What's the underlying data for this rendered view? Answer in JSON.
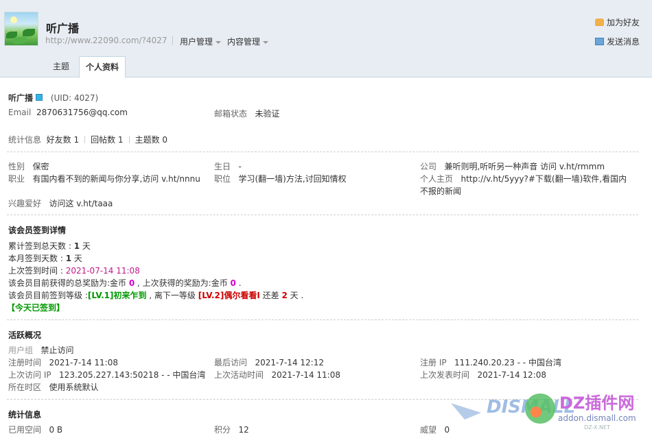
{
  "header": {
    "username": "听广播",
    "url": "http://www.22090.com/?4027",
    "menu_user": "用户管理",
    "menu_content": "内容管理",
    "add_friend": "加为好友",
    "send_message": "发送消息"
  },
  "tabs": [
    {
      "label": "主题"
    },
    {
      "label": "个人资料"
    }
  ],
  "profile": {
    "name": "听广播",
    "uid": "(UID: 4027)",
    "email_label": "Email",
    "email_value": "2870631756@qq.com",
    "email_status_label": "邮箱状态",
    "email_status_value": "未验证",
    "stats_label": "统计信息",
    "friends": "好友数 1",
    "replies": "回帖数 1",
    "threads": "主题数 0"
  },
  "details": {
    "gender_label": "性别",
    "gender_value": "保密",
    "birthday_label": "生日",
    "birthday_value": "-",
    "company_label": "公司",
    "company_value": "兼听则明,听听另一种声音 访问 v.ht/rmmm",
    "occupation_label": "职业",
    "occupation_value": "有国内看不到的新闻与你分享,访问 v.ht/nnnu",
    "position_label": "职位",
    "position_value": "学习(翻一墙)方法,讨回知情权",
    "homepage_label": "个人主页",
    "homepage_value_1": "http://v.ht/5yyy?#下载(翻一墙)软件,看国内",
    "homepage_value_2": "不报的新闻",
    "hobby_label": "兴趣爱好",
    "hobby_value": "访问这 v.ht/taaa"
  },
  "checkin": {
    "title": "该会员签到详情",
    "total_prefix": "累计签到总天数 : ",
    "total_days": "1",
    "total_suffix": " 天",
    "month_prefix": "本月签到天数 : ",
    "month_days": "1",
    "month_suffix": " 天",
    "last_prefix": "上次签到时间 : ",
    "last_time": "2021-07-14 11:08",
    "reward_prefix": "该会员目前获得的总奖励为:金币 ",
    "reward_total": "0",
    "reward_mid": " , 上次获得的奖励为:金币 ",
    "reward_last": "0",
    "reward_suffix": " .",
    "level_prefix": "该会员目前签到等级 :",
    "level_current": "[LV.1]初来乍到",
    "level_mid": " , 离下一等级 ",
    "level_next": "[LV.2]偶尔看看I",
    "level_gap_prefix": " 还差 ",
    "level_gap": "2",
    "level_gap_suffix": " 天 .",
    "today_status": "【今天已签到】"
  },
  "activity": {
    "title": "活跃概况",
    "group_label": "用户组",
    "group_value": "禁止访问",
    "reg_time_label": "注册时间",
    "reg_time_value": "2021-7-14 11:08",
    "last_visit_label": "最后访问",
    "last_visit_value": "2021-7-14 12:12",
    "reg_ip_label": "注册 IP",
    "reg_ip_value": "111.240.20.23 - - 中国台湾",
    "last_ip_label": "上次访问 IP",
    "last_ip_value": "123.205.227.143:50218 - - 中国台湾",
    "last_active_label": "上次活动时间",
    "last_active_value": "2021-7-14 11:08",
    "last_post_label": "上次发表时间",
    "last_post_value": "2021-7-14 12:08",
    "timezone_label": "所在时区",
    "timezone_value": "使用系统默认"
  },
  "stats": {
    "title": "统计信息",
    "space_label": "已用空间",
    "space_value": "0 B",
    "points_label": "积分",
    "points_value": "12",
    "prestige_label": "威望",
    "prestige_value": "0"
  },
  "watermark": {
    "brand": "DISMALL",
    "mid": "DZ插件网",
    "url": "addon.dismall.com",
    "sub": "DZ-X.NET"
  },
  "colors": {
    "header_bg": "#e8edf3",
    "checkin_time": "#c2188a",
    "reward": "#d400c8",
    "level_current": "#009900",
    "level_next": "#cc0000"
  }
}
